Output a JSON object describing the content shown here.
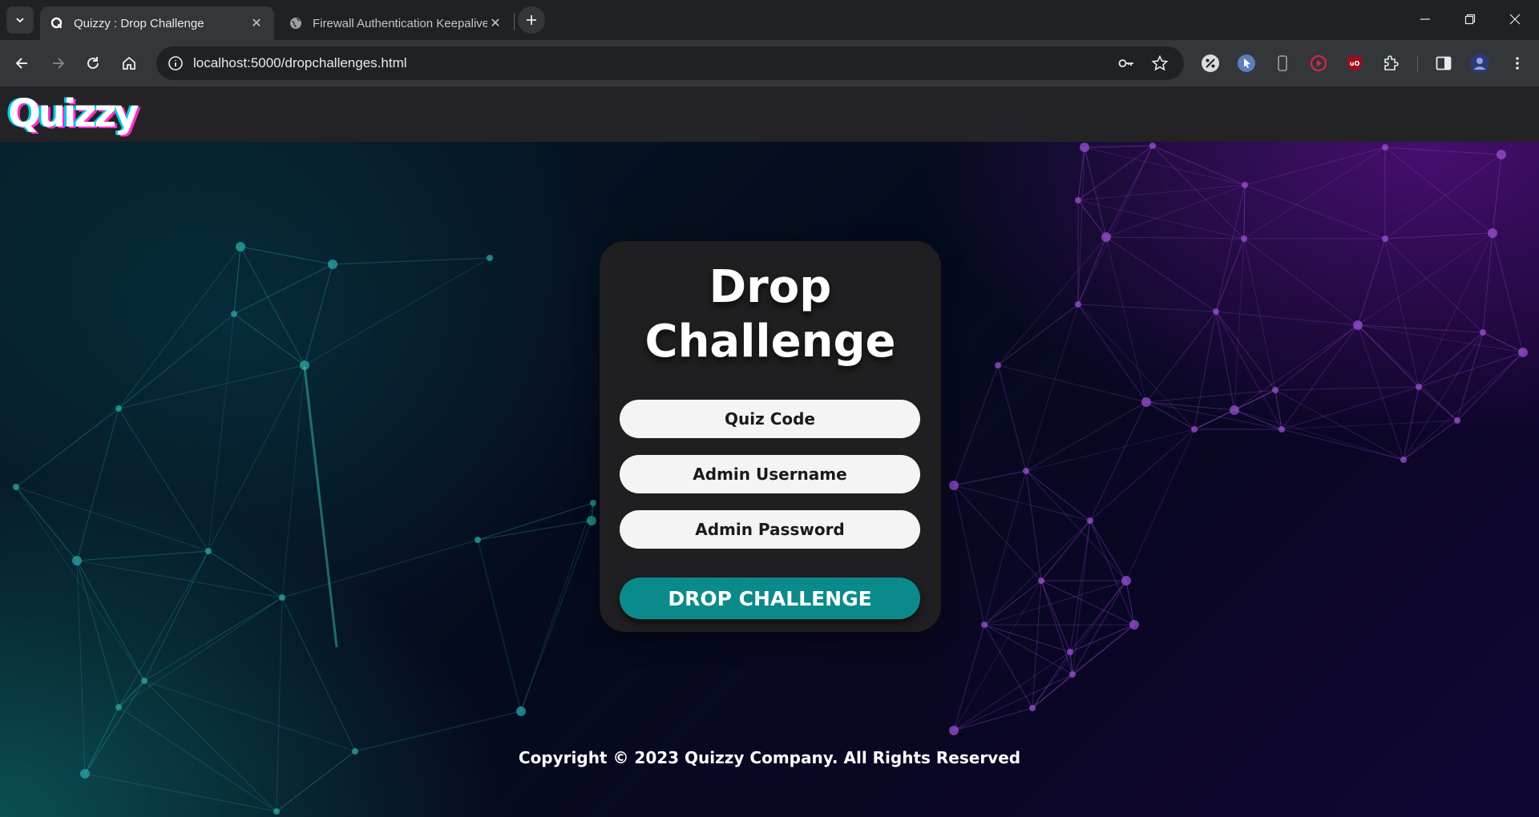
{
  "browser": {
    "tabs": [
      {
        "title": "Quizzy : Drop Challenge",
        "favicon": "q-logo-icon",
        "active": true
      },
      {
        "title": "Firewall Authentication Keepalive",
        "favicon": "globe-icon",
        "active": false
      }
    ],
    "url": "localhost:5000/dropchallenges.html",
    "extensions": [
      "percent-icon",
      "cursor-extension-icon",
      "device-icon",
      "record-extension-icon",
      "ublock-icon",
      "puzzle-icon"
    ]
  },
  "site": {
    "logo": "Quizzy"
  },
  "form": {
    "title": "Drop Challenge",
    "quiz_code_placeholder": "Quiz Code",
    "username_placeholder": "Admin Username",
    "password_placeholder": "Admin Password",
    "submit_label": "DROP CHALLENGE"
  },
  "footer": {
    "copyright": "Copyright © 2023 Quizzy Company. All Rights Reserved"
  },
  "colors": {
    "button": "#0b8a8c",
    "card": "#1f1f21",
    "navbar": "#232325"
  }
}
